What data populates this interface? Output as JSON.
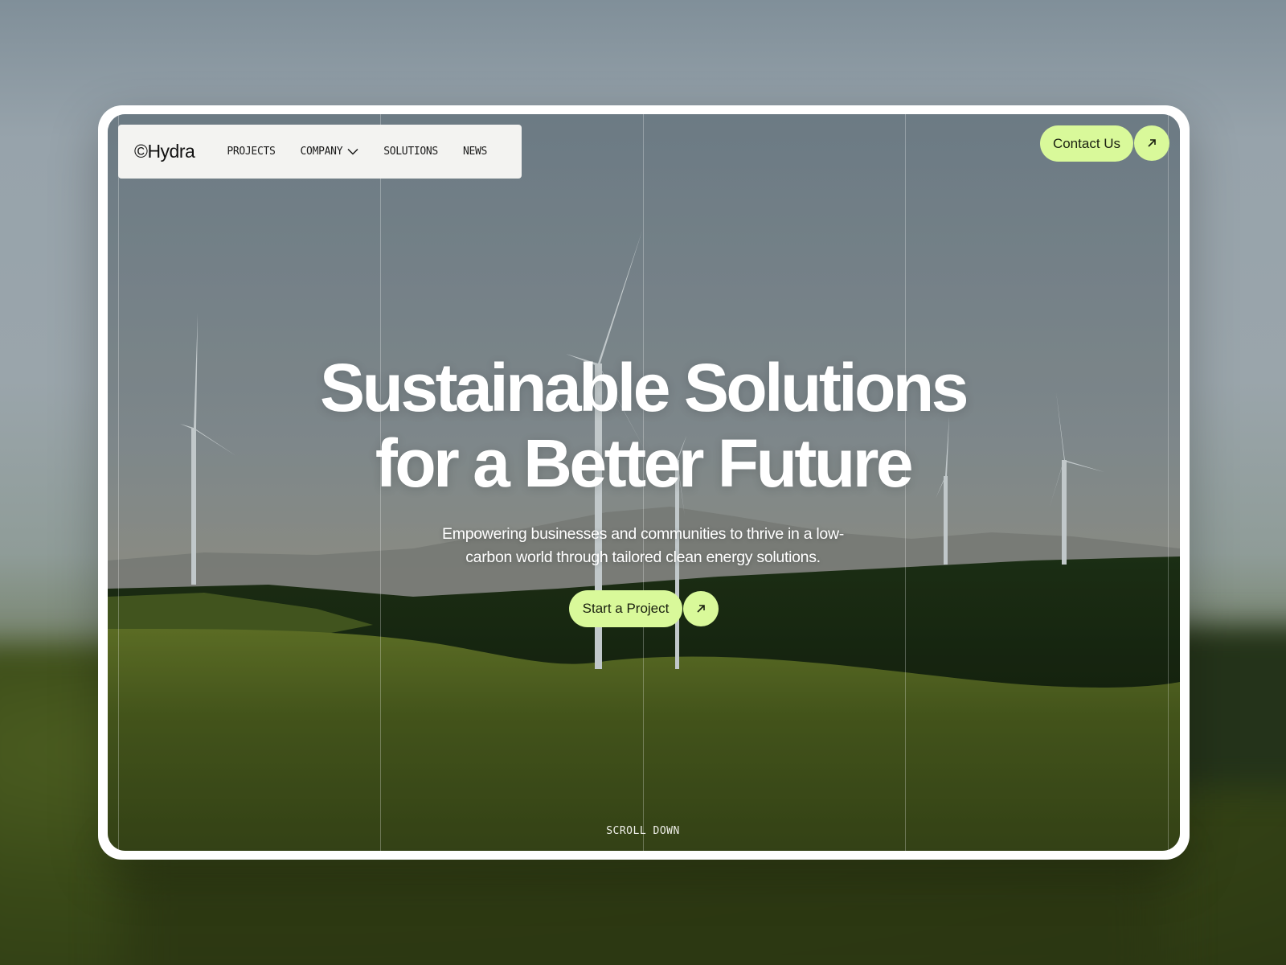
{
  "brand": {
    "logo_text": "©Hydra"
  },
  "nav": {
    "items": [
      {
        "label": "PROJECTS"
      },
      {
        "label": "COMPANY",
        "has_dropdown": true
      },
      {
        "label": "SOLUTIONS"
      },
      {
        "label": "NEWS"
      }
    ]
  },
  "header": {
    "contact_label": "Contact Us"
  },
  "hero": {
    "headline_line1": "Sustainable Solutions",
    "headline_line2": "for a Better Future",
    "subtitle_line1": "Empowering businesses and communities to thrive in a low-",
    "subtitle_line2": "carbon world through tailored clean energy solutions.",
    "cta_label": "Start a Project",
    "scroll_label": "SCROLL DOWN"
  },
  "icons": {
    "arrow": "arrow-up-right-icon",
    "dropdown": "chevron-down-icon"
  },
  "colors": {
    "accent": "#d9f99a",
    "frame": "#ffffff",
    "nav_bg": "#f3f3f1",
    "text_dark": "#111111",
    "text_light": "#ffffff"
  }
}
